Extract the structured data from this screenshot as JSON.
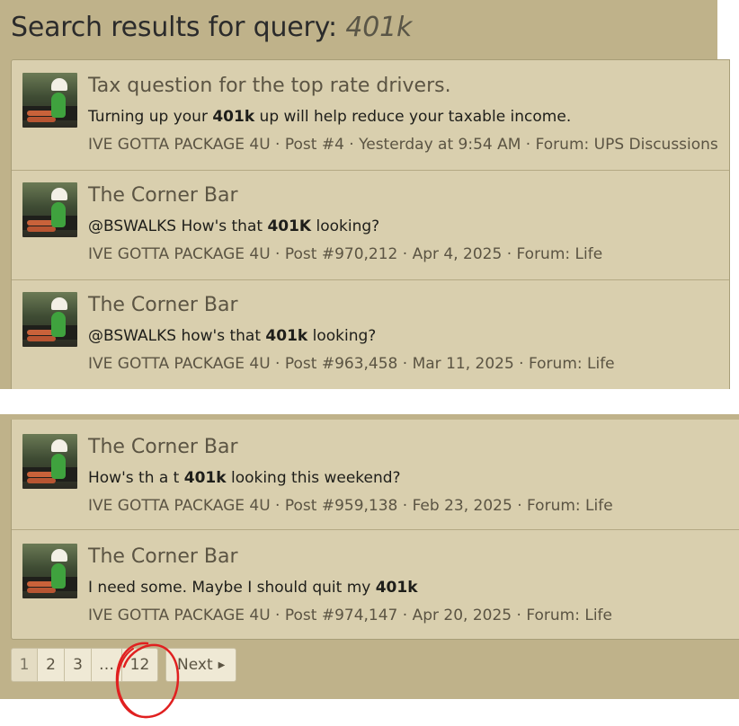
{
  "header": {
    "title_prefix": "Search results for query:",
    "query": "401k"
  },
  "results": [
    {
      "title": "Tax question for the top rate drivers.",
      "snippet_before": "Turning up your ",
      "snippet_highlight": "401k",
      "snippet_after": " up will help reduce your taxable income.",
      "meta": "IVE GOTTA PACKAGE 4U · Post #4 · Yesterday at 9:54 AM · Forum: UPS Discussions"
    },
    {
      "title": "The Corner Bar",
      "snippet_before": "@BSWALKS How's that ",
      "snippet_highlight": "401K",
      "snippet_after": " looking?",
      "meta": "IVE GOTTA PACKAGE 4U · Post #970,212 · Apr 4, 2025 · Forum: Life"
    },
    {
      "title": "The Corner Bar",
      "snippet_before": "@BSWALKS how's that ",
      "snippet_highlight": "401k",
      "snippet_after": " looking?",
      "meta": "IVE GOTTA PACKAGE 4U · Post #963,458 · Mar 11, 2025 · Forum: Life"
    },
    {
      "title": "The Corner Bar",
      "snippet_before": "How's th a t ",
      "snippet_highlight": "401k",
      "snippet_after": " looking this weekend?",
      "meta": "IVE GOTTA PACKAGE 4U · Post #959,138 · Feb 23, 2025 · Forum: Life"
    },
    {
      "title": "The Corner Bar",
      "snippet_before": "I need some. Maybe I should quit my ",
      "snippet_highlight": "401k",
      "snippet_after": "",
      "meta": "IVE GOTTA PACKAGE 4U · Post #974,147 · Apr 20, 2025 · Forum: Life"
    }
  ],
  "pagination": {
    "pages": [
      "1",
      "2",
      "3",
      "…",
      "12"
    ],
    "current": "1",
    "next_label": "Next",
    "next_icon": "caret-right-icon"
  },
  "colors": {
    "panel_bg": "#bfb28a",
    "result_bg": "#d9cfae",
    "annotation_red": "#e02020"
  }
}
